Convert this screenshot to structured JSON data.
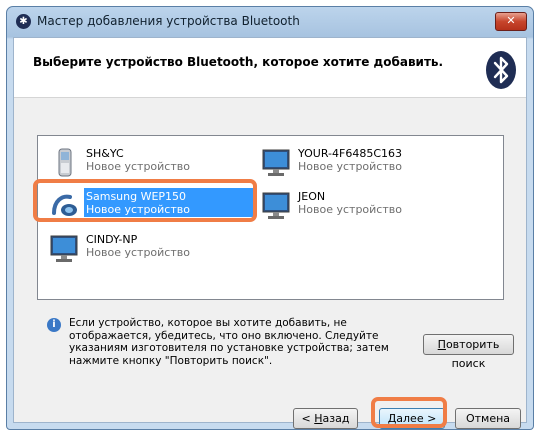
{
  "window": {
    "title": "Мастер добавления устройства Bluetooth",
    "close_glyph": "✕"
  },
  "header": {
    "title": "Выберите устройство Bluetooth, которое хотите добавить."
  },
  "devices": [
    {
      "name": "SH&YC",
      "subtitle": "Новое устройство",
      "icon": "phone-icon",
      "selected": false
    },
    {
      "name": "YOUR-4F6485C163",
      "subtitle": "Новое устройство",
      "icon": "computer-icon",
      "selected": false
    },
    {
      "name": "Samsung WEP150",
      "subtitle": "Новое устройство",
      "icon": "headset-icon",
      "selected": true
    },
    {
      "name": "JEON",
      "subtitle": "Новое устройство",
      "icon": "computer-icon",
      "selected": false
    },
    {
      "name": "CINDY-NP",
      "subtitle": "Новое устройство",
      "icon": "computer-icon",
      "selected": false
    }
  ],
  "info": {
    "text": "Если устройство, которое вы хотите добавить, не отображается, убедитесь, что оно включено. Следуйте указаниям изготовителя по установке устройства; затем нажмите кнопку \"Повторить поиск\"."
  },
  "buttons": {
    "retry_first": "П",
    "retry_rest": "овторить поиск",
    "back_prefix": "< ",
    "back_first": "Н",
    "back_rest": "азад",
    "next_first": "Д",
    "next_rest": "алее >",
    "cancel": "Отмена"
  },
  "colors": {
    "selection": "#3399ff",
    "highlight": "#f07d46"
  }
}
